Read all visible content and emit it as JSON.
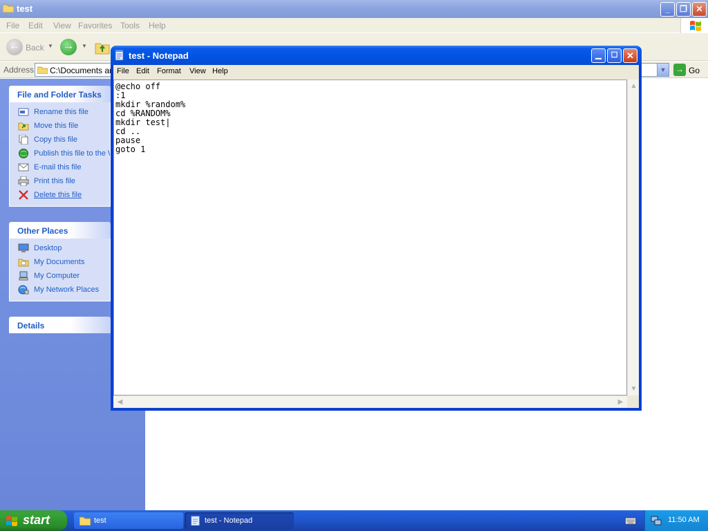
{
  "explorer": {
    "title": "test",
    "menu": [
      "File",
      "Edit",
      "View",
      "Favorites",
      "Tools",
      "Help"
    ],
    "toolbar": {
      "back_label": "Back"
    },
    "address": {
      "label": "Address",
      "value": "C:\\Documents and",
      "go_label": "Go"
    },
    "task_pane": {
      "file_tasks": {
        "title": "File and Folder Tasks",
        "items": [
          {
            "label": "Rename this file",
            "icon": "rename-icon"
          },
          {
            "label": "Move this file",
            "icon": "move-icon"
          },
          {
            "label": "Copy this file",
            "icon": "copy-icon"
          },
          {
            "label": "Publish this file to the W",
            "icon": "publish-icon"
          },
          {
            "label": "E-mail this file",
            "icon": "email-icon"
          },
          {
            "label": "Print this file",
            "icon": "print-icon"
          },
          {
            "label": "Delete this file",
            "icon": "delete-icon"
          }
        ]
      },
      "other_places": {
        "title": "Other Places",
        "items": [
          {
            "label": "Desktop",
            "icon": "desktop-icon"
          },
          {
            "label": "My Documents",
            "icon": "my-documents-icon"
          },
          {
            "label": "My Computer",
            "icon": "my-computer-icon"
          },
          {
            "label": "My Network Places",
            "icon": "network-places-icon"
          }
        ]
      },
      "details": {
        "title": "Details"
      }
    }
  },
  "notepad": {
    "title": "test - Notepad",
    "menu": [
      "File",
      "Edit",
      "Format",
      "View",
      "Help"
    ],
    "content": "@echo off\n:1\nmkdir %random%\ncd %RANDOM%\nmkdir test|\ncd ..\npause\ngoto 1"
  },
  "taskbar": {
    "start_label": "start",
    "tasks": [
      {
        "label": "test",
        "icon": "folder-icon"
      },
      {
        "label": "test - Notepad",
        "icon": "notepad-icon"
      }
    ],
    "clock": "11:50 AM"
  },
  "colors": {
    "xp_blue_title": "#0053e1",
    "task_pane_blue": "#6a86d8",
    "link_blue": "#215dc6",
    "start_green": "#36a336"
  }
}
